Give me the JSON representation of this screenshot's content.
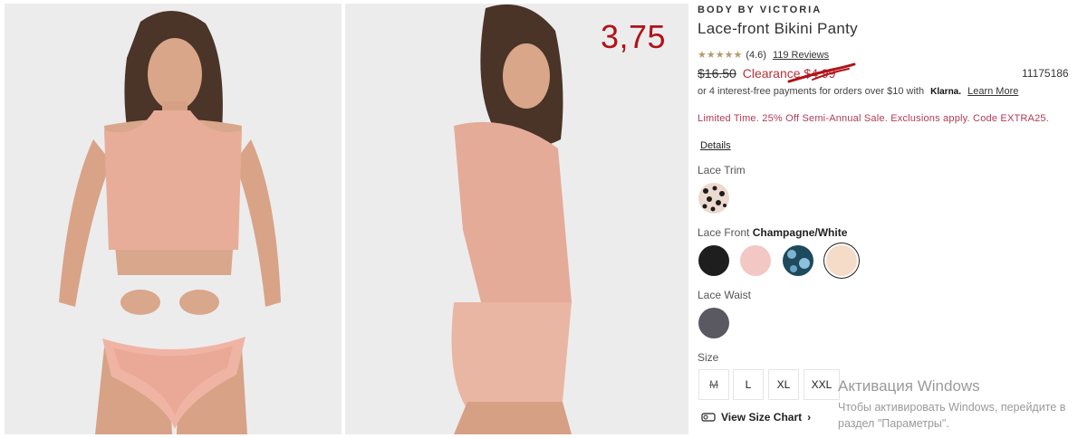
{
  "overlay": {
    "price_note": "3,75"
  },
  "product": {
    "brand": "BODY BY VICTORIA",
    "title": "Lace-front Bikini Panty",
    "rating": {
      "stars": "★★★★★",
      "value": "(4.6)",
      "reviews": "119 Reviews",
      "score": 4.6
    },
    "original_price": "$16.50",
    "clearance_price": "Clearance $4.99",
    "sku": "11175186",
    "klarna": {
      "text": "or 4 interest-free payments for orders over $10 with",
      "logo": "Klarna.",
      "link": "Learn More"
    },
    "promo": "Limited Time. 25% Off Semi-Annual Sale. Exclusions apply. Code EXTRA25.",
    "details_link": "Details"
  },
  "options": {
    "lace_trim": {
      "label": "Lace Trim",
      "swatches": [
        {
          "name": "leopard-print",
          "color": "#e8d3c8"
        }
      ]
    },
    "lace_front": {
      "label": "Lace Front",
      "selected": "Champagne/White",
      "swatches": [
        {
          "name": "black",
          "color": "#1e1e1e"
        },
        {
          "name": "pink",
          "color": "#f2c7c4"
        },
        {
          "name": "teal-floral",
          "color": "#1d4a5c"
        },
        {
          "name": "champagne-white",
          "color": "#f4dcc8"
        }
      ]
    },
    "lace_waist": {
      "label": "Lace Waist",
      "swatches": [
        {
          "name": "charcoal",
          "color": "#5a5860"
        }
      ]
    },
    "size": {
      "label": "Size",
      "sizes": [
        {
          "label": "M",
          "available": false
        },
        {
          "label": "L",
          "available": true
        },
        {
          "label": "XL",
          "available": true
        },
        {
          "label": "XXL",
          "available": true
        }
      ],
      "chart_link": "View Size Chart"
    }
  },
  "windows_watermark": {
    "title": "Активация Windows",
    "subtitle": "Чтобы активировать Windows, перейдите в раздел \"Параметры\"."
  },
  "colors": {
    "accent": "#b7323a",
    "promo": "#b23b55",
    "star": "#b89a6d",
    "overlay_price": "#b01218"
  }
}
